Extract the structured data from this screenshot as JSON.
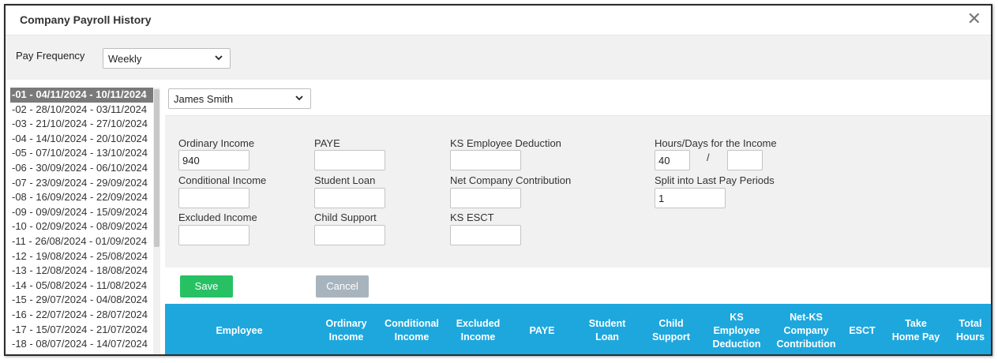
{
  "window": {
    "title": "Company Payroll History"
  },
  "frequency": {
    "label": "Pay Frequency",
    "selected": "Weekly"
  },
  "periods": [
    "-01 - 04/11/2024 - 10/11/2024",
    "-02 - 28/10/2024 - 03/11/2024",
    "-03 - 21/10/2024 - 27/10/2024",
    "-04 - 14/10/2024 - 20/10/2024",
    "-05 - 07/10/2024 - 13/10/2024",
    "-06 - 30/09/2024 - 06/10/2024",
    "-07 - 23/09/2024 - 29/09/2024",
    "-08 - 16/09/2024 - 22/09/2024",
    "-09 - 09/09/2024 - 15/09/2024",
    "-10 - 02/09/2024 - 08/09/2024",
    "-11 - 26/08/2024 - 01/09/2024",
    "-12 - 19/08/2024 - 25/08/2024",
    "-13 - 12/08/2024 - 18/08/2024",
    "-14 - 05/08/2024 - 11/08/2024",
    "-15 - 29/07/2024 - 04/08/2024",
    "-16 - 22/07/2024 - 28/07/2024",
    "-17 - 15/07/2024 - 21/07/2024",
    "-18 - 08/07/2024 - 14/07/2024"
  ],
  "employee": {
    "selected": "James Smith"
  },
  "form": {
    "ordinary_income": {
      "label": "Ordinary Income",
      "value": "940"
    },
    "conditional_income": {
      "label": "Conditional Income",
      "value": ""
    },
    "excluded_income": {
      "label": "Excluded Income",
      "value": ""
    },
    "paye": {
      "label": "PAYE",
      "value": ""
    },
    "student_loan": {
      "label": "Student Loan",
      "value": ""
    },
    "child_support": {
      "label": "Child Support",
      "value": ""
    },
    "ks_employee_deduction": {
      "label": "KS Employee Deduction",
      "value": ""
    },
    "net_company_contribution": {
      "label": "Net Company Contribution",
      "value": ""
    },
    "ks_esct": {
      "label": "KS ESCT",
      "value": ""
    },
    "hours_days": {
      "label": "Hours/Days for the Income",
      "value": "40",
      "value2": "",
      "separator": "/"
    },
    "split_periods": {
      "label": "Split into Last Pay Periods",
      "value": "1"
    }
  },
  "buttons": {
    "save": "Save",
    "cancel": "Cancel"
  },
  "table": {
    "headers": [
      "Employee",
      "Ordinary\nIncome",
      "Conditional\nIncome",
      "Excluded\nIncome",
      "PAYE",
      "Student\nLoan",
      "Child\nSupport",
      "KS\nEmployee\nDeduction",
      "Net-KS\nCompany\nContribution",
      "ESCT",
      "Take\nHome Pay",
      "Total\nHours"
    ]
  },
  "colors": {
    "save": "#27c164",
    "cancel": "#a8b4bd",
    "table_header": "#1ea7dd",
    "selected_period": "#7a7a7a"
  },
  "icons": {
    "close": "close-icon",
    "dropdown": "chevron-down-icon"
  }
}
